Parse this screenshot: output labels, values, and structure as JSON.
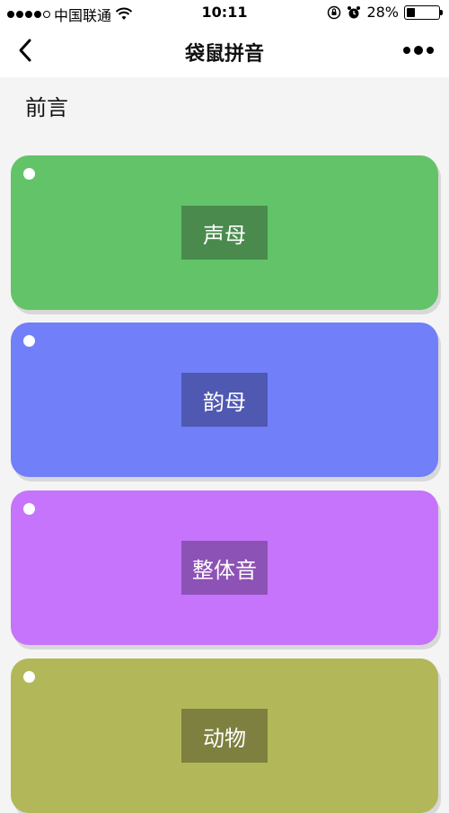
{
  "status_bar": {
    "carrier": "中国联通",
    "time": "10:11",
    "battery_percent": "28%",
    "battery_level": 0.28,
    "icons": [
      "wifi-icon",
      "orientation-lock-icon",
      "alarm-icon",
      "battery-icon"
    ]
  },
  "nav": {
    "title": "袋鼠拼音",
    "back_icon": "chevron-left-icon",
    "more_icon": "more-dots-icon"
  },
  "section": {
    "title": "前言"
  },
  "cards": [
    {
      "label": "声母",
      "bg": "#63c369",
      "label_bg": "#4a8b4d"
    },
    {
      "label": "韵母",
      "bg": "#717ff9",
      "label_bg": "#5059b2"
    },
    {
      "label": "整体音",
      "bg": "#c574fb",
      "label_bg": "#8d52b5"
    },
    {
      "label": "动物",
      "bg": "#b2b85a",
      "label_bg": "#7d803f"
    }
  ]
}
